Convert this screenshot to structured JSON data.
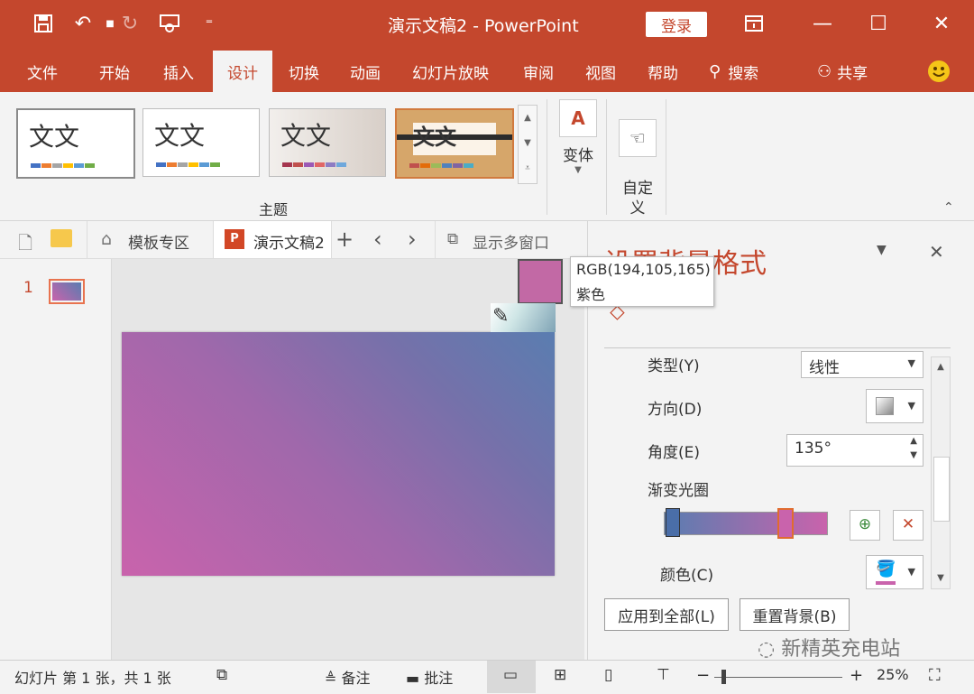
{
  "window": {
    "title": "演示文稿2 - PowerPoint",
    "login": "登录",
    "accent": "#c4472d"
  },
  "quick_access": {
    "icons": [
      "save-icon",
      "undo-icon",
      "redo-icon",
      "presenter-icon",
      "customize-dropdown-icon"
    ]
  },
  "window_controls": {
    "icons": [
      "ribbon-display-icon",
      "minimize-icon",
      "maximize-icon",
      "close-icon"
    ]
  },
  "menu": {
    "items": [
      "文件",
      "开始",
      "插入",
      "设计",
      "切换",
      "动画",
      "幻灯片放映",
      "审阅",
      "视图",
      "帮助"
    ],
    "active": "设计",
    "search": "搜索",
    "share": "共享"
  },
  "ribbon": {
    "themes_group": "主题",
    "theme_text": "文文",
    "variants": "变体",
    "customize": "自定\n义"
  },
  "tabs": {
    "templates": "模板专区",
    "doc": "演示文稿2",
    "multiwindow": "显示多窗口"
  },
  "slides": {
    "number": "1"
  },
  "tooltip": {
    "rgb": "RGB(194,105,165)",
    "name": "紫色",
    "color": "#c269a5"
  },
  "panel": {
    "title": "设置背景格式",
    "type_label": "类型(Y)",
    "type_value": "线性",
    "direction_label": "方向(D)",
    "angle_label": "角度(E)",
    "angle_value": "135°",
    "stops_label": "渐变光圈",
    "color_label": "颜色(C)",
    "apply_all": "应用到全部(L)",
    "reset_bg": "重置背景(B)"
  },
  "gradient": {
    "start": "#5a7db0",
    "end": "#c963ac"
  },
  "statusbar": {
    "slide_info": "幻灯片 第 1 张，共 1 张",
    "notes": "备注",
    "comments": "批注",
    "zoom": "25%"
  },
  "watermark": "新精英充电站"
}
